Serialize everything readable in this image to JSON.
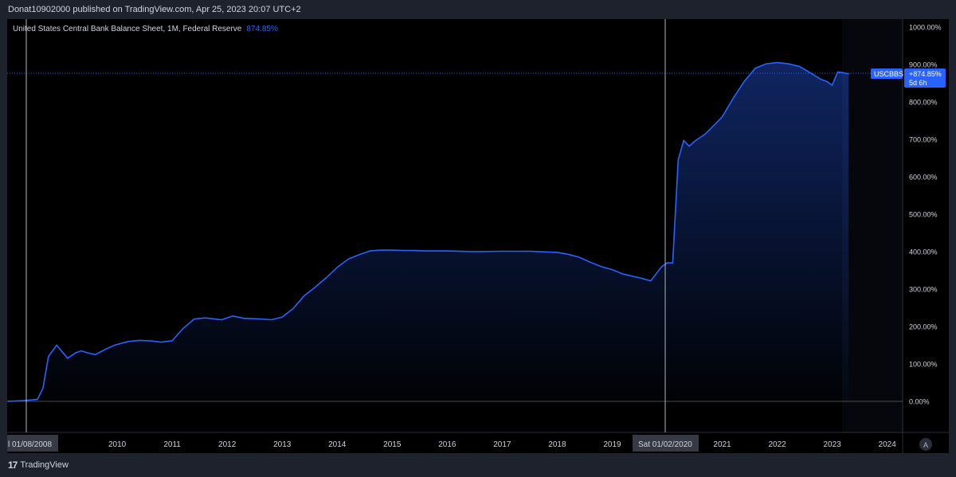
{
  "header": {
    "published": "Donat10902000 published on TradingView.com, Apr 25, 2023 20:07 UTC+2"
  },
  "legend": {
    "title": "United States Central Bank Balance Sheet, 1M, Federal Reserve",
    "value": "874.85%"
  },
  "price_label": {
    "symbol": "USCBBS",
    "change": "+874.85%",
    "countdown": "5d 6h"
  },
  "crosshair_labels": {
    "left": "l 01/08/2008",
    "right": "Sat 01/02/2020"
  },
  "auto_button": "A",
  "footer": {
    "brand": "TradingView"
  },
  "colors": {
    "line": "#2962ff",
    "background": "#000000",
    "accent": "#2962ff"
  },
  "chart_data": {
    "type": "area",
    "title": "United States Central Bank Balance Sheet, 1M, Federal Reserve",
    "xlabel": "",
    "ylabel": "",
    "ylim": [
      0,
      1000
    ],
    "xlim": [
      2008.0,
      2024.28
    ],
    "y_ticks": [
      "0.00%",
      "100.00%",
      "200.00%",
      "300.00%",
      "400.00%",
      "500.00%",
      "600.00%",
      "700.00%",
      "800.00%",
      "900.00%",
      "1000.00%"
    ],
    "y_tick_values": [
      0,
      100,
      200,
      300,
      400,
      500,
      600,
      700,
      800,
      900,
      1000
    ],
    "x_ticks": [
      "2010",
      "2011",
      "2012",
      "2013",
      "2014",
      "2015",
      "2016",
      "2017",
      "2018",
      "2019",
      "2021",
      "2022",
      "2023",
      "2024"
    ],
    "x_tick_values": [
      2010,
      2011,
      2012,
      2013,
      2014,
      2015,
      2016,
      2017,
      2018,
      2019,
      2021,
      2022,
      2023,
      2024
    ],
    "series": [
      {
        "x": [
          2008.0,
          2008.3,
          2008.55,
          2008.65,
          2008.75,
          2008.9,
          2009.1,
          2009.25,
          2009.35,
          2009.45,
          2009.6,
          2009.8,
          2009.95,
          2010.2,
          2010.4,
          2010.6,
          2010.8,
          2011.0,
          2011.2,
          2011.4,
          2011.6,
          2011.9,
          2012.1,
          2012.3,
          2012.6,
          2012.8,
          2013.0,
          2013.2,
          2013.4,
          2013.6,
          2013.8,
          2014.0,
          2014.2,
          2014.4,
          2014.6,
          2014.8,
          2015.0,
          2015.2,
          2015.4,
          2015.6,
          2016.0,
          2016.5,
          2017.0,
          2017.5,
          2018.0,
          2018.2,
          2018.4,
          2018.6,
          2018.8,
          2019.0,
          2019.2,
          2019.5,
          2019.7,
          2019.9,
          2020.0,
          2020.1,
          2020.2,
          2020.3,
          2020.4,
          2020.5,
          2020.7,
          2020.9,
          2021.0,
          2021.2,
          2021.4,
          2021.6,
          2021.8,
          2022.0,
          2022.2,
          2022.4,
          2022.6,
          2022.8,
          2022.9,
          2023.0,
          2023.1,
          2023.2,
          2023.3
        ],
        "y": [
          0,
          2,
          5,
          35,
          120,
          150,
          115,
          130,
          135,
          130,
          125,
          140,
          150,
          160,
          163,
          162,
          158,
          162,
          195,
          220,
          223,
          218,
          228,
          222,
          220,
          218,
          225,
          248,
          282,
          305,
          330,
          358,
          380,
          392,
          402,
          404,
          404,
          403,
          403,
          402,
          402,
          400,
          401,
          401,
          398,
          393,
          385,
          372,
          360,
          352,
          340,
          330,
          322,
          360,
          370,
          370,
          645,
          697,
          682,
          695,
          715,
          745,
          760,
          810,
          855,
          890,
          902,
          905,
          902,
          895,
          878,
          860,
          855,
          845,
          880,
          878,
          875
        ]
      }
    ]
  }
}
